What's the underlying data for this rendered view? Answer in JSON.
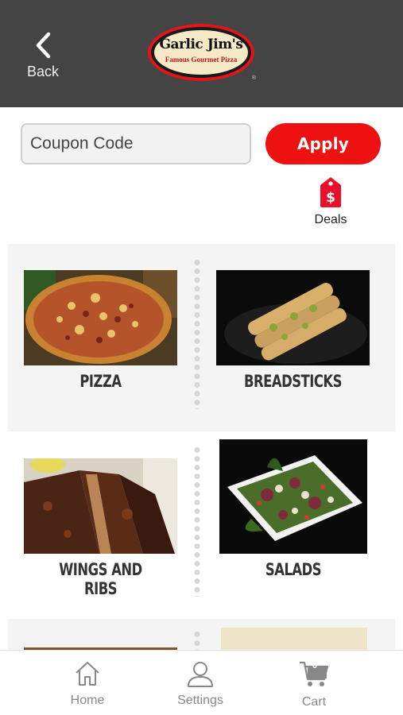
{
  "header": {
    "back_label": "Back",
    "logo_brand": "Garlic Jim's",
    "logo_tagline": "Famous Gourmet Pizza"
  },
  "coupon": {
    "placeholder": "Coupon Code",
    "value": "",
    "apply_label": "Apply"
  },
  "deals": {
    "label": "Deals",
    "icon": "price-tag-icon"
  },
  "menu": {
    "items": [
      {
        "label": "PIZZA",
        "image": "pizza-photo"
      },
      {
        "label": "BREADSTICKS",
        "image": "breadsticks-photo"
      },
      {
        "label": "WINGS AND RIBS",
        "image": "wings-ribs-photo"
      },
      {
        "label": "SALADS",
        "image": "salad-photo"
      }
    ]
  },
  "tabbar": {
    "home_label": "Home",
    "settings_label": "Settings",
    "cart_label": "Cart",
    "cart_count": "0"
  },
  "colors": {
    "header_bg": "#444444",
    "accent_red": "#ee1111",
    "row_bg": "#f4f4f4",
    "tab_icon": "#888888"
  }
}
